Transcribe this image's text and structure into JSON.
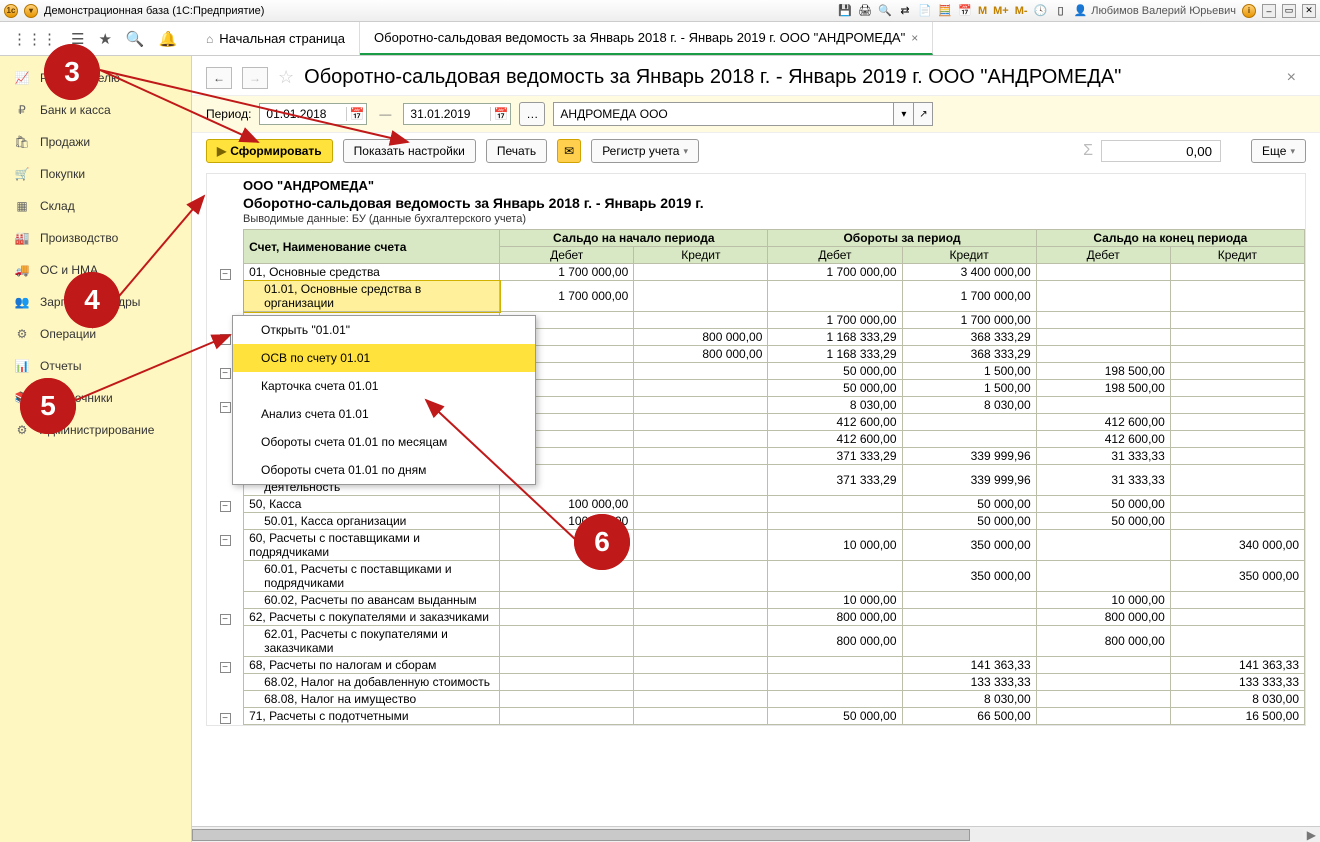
{
  "titlebar": {
    "title": "Демонстрационная база  (1С:Предприятие)",
    "user": "Любимов Валерий Юрьевич",
    "m_buttons": [
      "M",
      "M+",
      "M-"
    ]
  },
  "tabs": {
    "home": "Начальная страница",
    "active": "Оборотно-сальдовая ведомость за Январь 2018 г. - Январь 2019 г. ООО \"АНДРОМЕДА\""
  },
  "sidebar": {
    "items": [
      "Руководителю",
      "Банк и касса",
      "Продажи",
      "Покупки",
      "Склад",
      "Производство",
      "ОС и НМА",
      "Зарплата и кадры",
      "Операции",
      "Отчеты",
      "Справочники",
      "Администрирование"
    ],
    "icons": [
      "📈",
      "₽",
      "🛍",
      "🛒",
      "▦",
      "🏭",
      "🚚",
      "👥",
      "⚙",
      "📊",
      "📚",
      "⚙"
    ]
  },
  "page": {
    "title": "Оборотно-сальдовая ведомость за Январь 2018 г. - Январь 2019 г. ООО \"АНДРОМЕДА\""
  },
  "toolbar1": {
    "period_label": "Период:",
    "date_from": "01.01.2018",
    "date_to": "31.01.2019",
    "org": "АНДРОМЕДА ООО"
  },
  "toolbar2": {
    "generate": "Сформировать",
    "show_settings": "Показать настройки",
    "print": "Печать",
    "register": "Регистр учета",
    "more": "Еще",
    "sum_value": "0,00"
  },
  "report": {
    "org_line": "ООО \"АНДРОМЕДА\"",
    "title": "Оборотно-сальдовая ведомость за Январь 2018 г. - Январь 2019 г.",
    "note": "Выводимые данные:  БУ (данные бухгалтерского учета)",
    "head_account": "Счет, Наименование счета",
    "head_groups": [
      "Сальдо на начало периода",
      "Обороты за период",
      "Сальдо на конец периода"
    ],
    "head_sub": [
      "Дебет",
      "Кредит",
      "Дебет",
      "Кредит",
      "Дебет",
      "Кредит"
    ],
    "rows": [
      {
        "exp": "⊟",
        "ind": 0,
        "acc": "01, Основные средства",
        "d1": "1 700 000,00",
        "c1": "",
        "d2": "1 700 000,00",
        "c2": "3 400 000,00",
        "d3": "",
        "c3": ""
      },
      {
        "exp": "",
        "ind": 1,
        "acc": "01.01, Основные средства в организации",
        "d1": "1 700 000,00",
        "c1": "",
        "d2": "",
        "c2": "1 700 000,00",
        "d3": "",
        "c3": "",
        "hl": true
      },
      {
        "exp": "",
        "ind": 1,
        "acc": "",
        "d1": "",
        "c1": "",
        "d2": "1 700 000,00",
        "c2": "1 700 000,00",
        "d3": "",
        "c3": ""
      },
      {
        "exp": "⊟",
        "ind": 0,
        "acc": "",
        "d1": "",
        "c1": "800 000,00",
        "d2": "1 168 333,29",
        "c2": "368 333,29",
        "d3": "",
        "c3": ""
      },
      {
        "exp": "",
        "ind": 1,
        "acc": "",
        "d1": "",
        "c1": "800 000,00",
        "d2": "1 168 333,29",
        "c2": "368 333,29",
        "d3": "",
        "c3": ""
      },
      {
        "exp": "⊟",
        "ind": 0,
        "acc": "",
        "d1": "",
        "c1": "",
        "d2": "50 000,00",
        "c2": "1 500,00",
        "d3": "198 500,00",
        "c3": ""
      },
      {
        "exp": "",
        "ind": 1,
        "acc": "",
        "d1": "",
        "c1": "",
        "d2": "50 000,00",
        "c2": "1 500,00",
        "d3": "198 500,00",
        "c3": ""
      },
      {
        "exp": "⊟",
        "ind": 0,
        "acc": "",
        "d1": "",
        "c1": "",
        "d2": "8 030,00",
        "c2": "8 030,00",
        "d3": "",
        "c3": ""
      },
      {
        "exp": "",
        "ind": 1,
        "acc": "",
        "d1": "",
        "c1": "",
        "d2": "412 600,00",
        "c2": "",
        "d3": "412 600,00",
        "c3": ""
      },
      {
        "exp": "",
        "ind": 1,
        "acc": "",
        "d1": "",
        "c1": "",
        "d2": "412 600,00",
        "c2": "",
        "d3": "412 600,00",
        "c3": ""
      },
      {
        "exp": "",
        "ind": 1,
        "acc": "",
        "d1": "",
        "c1": "",
        "d2": "371 333,29",
        "c2": "339 999,96",
        "d3": "31 333,33",
        "c3": ""
      },
      {
        "exp": "",
        "ind": 1,
        "acc": "организации, осуществляющих торговую деятельность",
        "d1": "",
        "c1": "",
        "d2": "371 333,29",
        "c2": "339 999,96",
        "d3": "31 333,33",
        "c3": ""
      },
      {
        "exp": "⊟",
        "ind": 0,
        "acc": "50, Касса",
        "d1": "100 000,00",
        "c1": "",
        "d2": "",
        "c2": "50 000,00",
        "d3": "50 000,00",
        "c3": ""
      },
      {
        "exp": "",
        "ind": 1,
        "acc": "50.01, Касса организации",
        "d1": "100 000,00",
        "c1": "",
        "d2": "",
        "c2": "50 000,00",
        "d3": "50 000,00",
        "c3": ""
      },
      {
        "exp": "⊟",
        "ind": 0,
        "acc": "60, Расчеты с поставщиками и подрядчиками",
        "d1": "",
        "c1": "",
        "d2": "10 000,00",
        "c2": "350 000,00",
        "d3": "",
        "c3": "340 000,00"
      },
      {
        "exp": "",
        "ind": 1,
        "acc": "60.01, Расчеты с поставщиками и подрядчиками",
        "d1": "",
        "c1": "",
        "d2": "",
        "c2": "350 000,00",
        "d3": "",
        "c3": "350 000,00"
      },
      {
        "exp": "",
        "ind": 1,
        "acc": "60.02, Расчеты по авансам выданным",
        "d1": "",
        "c1": "",
        "d2": "10 000,00",
        "c2": "",
        "d3": "10 000,00",
        "c3": ""
      },
      {
        "exp": "⊟",
        "ind": 0,
        "acc": "62, Расчеты с покупателями и заказчиками",
        "d1": "",
        "c1": "",
        "d2": "800 000,00",
        "c2": "",
        "d3": "800 000,00",
        "c3": ""
      },
      {
        "exp": "",
        "ind": 1,
        "acc": "62.01, Расчеты с покупателями и заказчиками",
        "d1": "",
        "c1": "",
        "d2": "800 000,00",
        "c2": "",
        "d3": "800 000,00",
        "c3": ""
      },
      {
        "exp": "⊟",
        "ind": 0,
        "acc": "68, Расчеты по налогам и сборам",
        "d1": "",
        "c1": "",
        "d2": "",
        "c2": "141 363,33",
        "d3": "",
        "c3": "141 363,33"
      },
      {
        "exp": "",
        "ind": 1,
        "acc": "68.02, Налог на добавленную стоимость",
        "d1": "",
        "c1": "",
        "d2": "",
        "c2": "133 333,33",
        "d3": "",
        "c3": "133 333,33"
      },
      {
        "exp": "",
        "ind": 1,
        "acc": "68.08, Налог на имущество",
        "d1": "",
        "c1": "",
        "d2": "",
        "c2": "8 030,00",
        "d3": "",
        "c3": "8 030,00"
      },
      {
        "exp": "⊟",
        "ind": 0,
        "acc": "71, Расчеты с подотчетными",
        "d1": "",
        "c1": "",
        "d2": "50 000,00",
        "c2": "66 500,00",
        "d3": "",
        "c3": "16 500,00"
      }
    ]
  },
  "context": {
    "items": [
      "Открыть \"01.01\"",
      "ОСВ по счету 01.01",
      "Карточка счета 01.01",
      "Анализ счета 01.01",
      "Обороты счета 01.01 по месяцам",
      "Обороты счета 01.01 по дням"
    ],
    "active_index": 1
  },
  "annotations": {
    "b3": "3",
    "b4": "4",
    "b5": "5",
    "b6": "6"
  }
}
